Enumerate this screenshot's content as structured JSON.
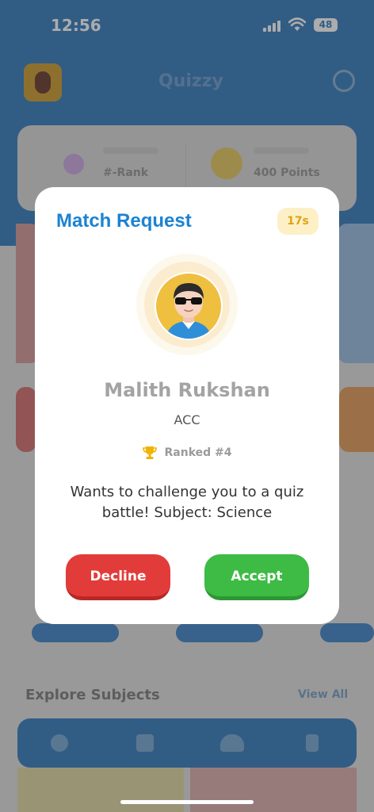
{
  "status_bar": {
    "time": "12:56",
    "battery": "48"
  },
  "background": {
    "app_title": "Quizzy",
    "stat_rank": "#-Rank",
    "stat_points": "400 Points",
    "explore_title": "Explore Subjects",
    "view_all": "View All"
  },
  "modal": {
    "title": "Match Request",
    "timer": "17s",
    "player_name": "Malith Rukshan",
    "player_org": "ACC",
    "rank": "Ranked #4",
    "message": "Wants to challenge you to a quiz battle! Subject: Science",
    "decline_label": "Decline",
    "accept_label": "Accept"
  },
  "colors": {
    "primary_blue": "#1b83d2",
    "decline_red": "#e23c3a",
    "accept_green": "#3dbb44",
    "timer_amber": "#e0a316",
    "trophy_gold": "#f0b400"
  },
  "icons": [
    "signal-icon",
    "wifi-icon",
    "battery-icon",
    "trophy-icon",
    "search-icon"
  ]
}
